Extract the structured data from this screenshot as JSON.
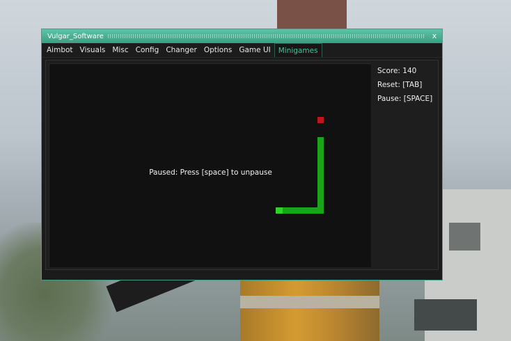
{
  "window": {
    "title": "Vulgar_Software",
    "close_glyph": "x"
  },
  "tabs": [
    {
      "label": "Aimbot",
      "active": false
    },
    {
      "label": "Visuals",
      "active": false
    },
    {
      "label": "Misc",
      "active": false
    },
    {
      "label": "Config",
      "active": false
    },
    {
      "label": "Changer",
      "active": false
    },
    {
      "label": "Options",
      "active": false
    },
    {
      "label": "Game UI",
      "active": false
    },
    {
      "label": "Minigames",
      "active": true
    }
  ],
  "game": {
    "pause_message": "Paused: Press [space] to unpause",
    "score_text": "Score: 140",
    "reset_text": "Reset: [TAB]",
    "pause_text": "Pause: [SPACE]"
  },
  "colors": {
    "accent": "#3aa38a",
    "snake": "#1aa41a",
    "snake_head": "#2fd12f",
    "food": "#c0151b"
  }
}
